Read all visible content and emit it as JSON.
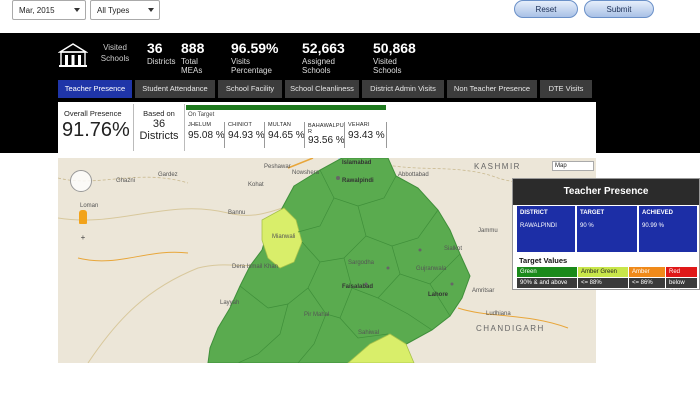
{
  "filters": {
    "month": "Mar, 2015",
    "type": "All Types",
    "reset_label": "Reset",
    "submit_label": "Submit"
  },
  "summary": {
    "visited_label": "Visited Schools",
    "items": [
      {
        "value": "36",
        "label": "Districts"
      },
      {
        "value": "888",
        "label": "Total MEAs"
      },
      {
        "value": "96.59%",
        "label": "Visits Percentage"
      },
      {
        "value": "52,663",
        "label": "Assigned Schools"
      },
      {
        "value": "50,868",
        "label": "Visited Schools"
      }
    ]
  },
  "tabs": [
    {
      "label": "Teacher Presence",
      "active": true
    },
    {
      "label": "Student Attendance",
      "active": false
    },
    {
      "label": "School Facility",
      "active": false
    },
    {
      "label": "School Cleanliness",
      "active": false
    },
    {
      "label": "District Admin Visits",
      "active": false
    },
    {
      "label": "Non Teacher Presence",
      "active": false
    },
    {
      "label": "DTE Visits",
      "active": false
    }
  ],
  "overview": {
    "overall_label": "Overall Presence",
    "overall_value": "91.76%",
    "based_on_label": "Based on",
    "based_on_count": "36",
    "based_on_unit": "Districts",
    "on_target_label": "On Target",
    "districts": [
      {
        "name": "JHELUM",
        "percent": "95.08 %"
      },
      {
        "name": "CHINIOT",
        "percent": "94.93 %"
      },
      {
        "name": "MULTAN",
        "percent": "94.65 %"
      },
      {
        "name": "BAHAWALPU R",
        "percent": "93.56 %"
      },
      {
        "name": "VEHARI",
        "percent": "93.43 %"
      }
    ]
  },
  "map": {
    "map_type_label": "Map",
    "labels": {
      "islamabad": "Islamabad",
      "rawalpindi": "Rawalpindi",
      "kashmir": "KASHMIR",
      "chandigarh": "CHANDIGARH",
      "ludhiana": "Ludhiana",
      "faisalabad": "Faisalabad",
      "lahore": "Lahore",
      "gujranwala": "Gujranwala",
      "sargodha": "Sargodha",
      "mianwali": "Mianwali",
      "dera_ismail": "Dera Ismail Khan",
      "bannu": "Bannu",
      "gardez": "Gardez",
      "ghazni": "Ghazni",
      "loman": "Loman",
      "pir_mahal": "Pir Mahal",
      "sahiwal": "Sahiwal",
      "layyah": "Layyah",
      "sialkot": "Sialkot",
      "jammu": "Jammu",
      "amritsar": "Amritsar",
      "kohat": "Kohat",
      "peshawar": "Peshawar",
      "nowshera": "Nowshera",
      "abbottabad": "Abbottabad"
    },
    "colors": {
      "green": "#5aab4f",
      "yellow": "#d9ee6a"
    }
  },
  "legend": {
    "title": "Teacher Presence",
    "district_header": "DISTRICT",
    "district_value": "RAWALPINDI",
    "target_header": "TARGET",
    "target_value": "90 %",
    "achieved_header": "ACHIEVED",
    "achieved_value": "90.99 %",
    "target_values_title": "Target Values",
    "levels": [
      {
        "name": "Green",
        "desc": "90% & and above",
        "color": "#1a8a1a"
      },
      {
        "name": "Amber Green",
        "desc": "<= 88%",
        "color": "#c8e64a"
      },
      {
        "name": "Amber",
        "desc": "<= 86%",
        "color": "#f08a1a"
      },
      {
        "name": "Red",
        "desc": "below 86%",
        "color": "#e01818"
      }
    ]
  }
}
